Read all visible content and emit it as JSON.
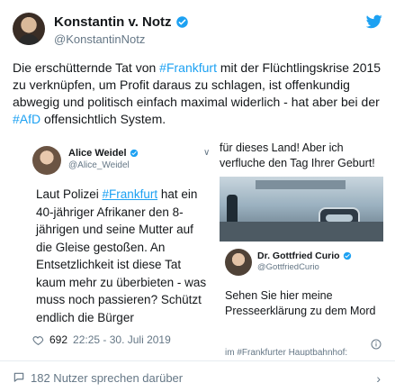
{
  "tweet": {
    "author_name": "Konstantin v. Notz",
    "handle": "@KonstantinNotz",
    "text_parts": {
      "p1": "Die erschütternde Tat von ",
      "tag1": "#Frankfurt",
      "p2": " mit der Flüchtlingskrise 2015 zu verknüpfen, um Profit daraus zu schlagen, ist offenkundig abwegig und politisch einfach maximal widerlich - hat aber bei der ",
      "tag2": "#AfD",
      "p3": " offensichtlich System."
    },
    "icons": {
      "verified": "verified-badge-icon",
      "brand": "twitter-bird-icon"
    },
    "colors": {
      "link": "#1da1f2",
      "secondary": "#657786",
      "verified": "#1da1f2"
    }
  },
  "quote_left": {
    "author_name": "Alice Weidel",
    "handle": "@Alice_Weidel",
    "text_parts": {
      "p1": "Laut Polizei ",
      "tag": "#Frankfurt",
      "p2": " hat ein 40-jähriger Afrikaner den 8-jährigen und seine Mutter auf die Gleise gestoßen. An Entsetzlichkeit ist diese Tat kaum mehr zu überbieten - was muss noch passieren? Schützt endlich die Bürger"
    },
    "likes": "692",
    "timestamp": "22:25 - 30. Juli 2019"
  },
  "quote_right": {
    "top_text": "für dieses Land! Aber ich verfluche den Tag Ihrer Geburt!",
    "author_name": "Dr. Gottfried Curio",
    "handle": "@GottfriedCurio",
    "text": "Sehen Sie hier meine Presseerklärung zu dem Mord",
    "cut_text": "im #Frankfurter Hauptbahnhof:"
  },
  "footer": {
    "replies_label": "182 Nutzer sprechen darüber"
  }
}
